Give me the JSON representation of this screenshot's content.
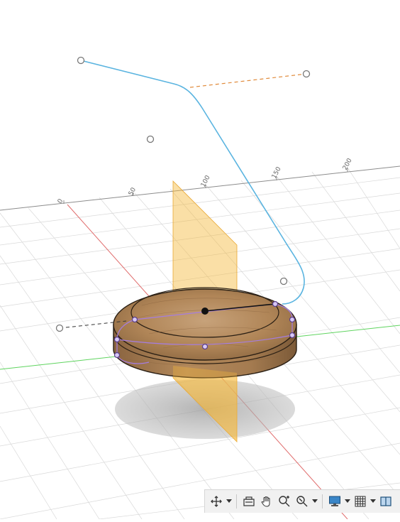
{
  "ruler": {
    "labels": [
      "0",
      "50",
      "100",
      "150",
      "200"
    ]
  },
  "colors": {
    "background": "#ffffff",
    "grid_line": "#d9d9d9",
    "x_axis": "#e06c6c",
    "y_axis": "#5fd45f",
    "path": "#5ab4e0",
    "tangent": "#e08a3a",
    "plane": "#f5b83a",
    "wood": "#b58b5e",
    "sketch": "#a57de0"
  },
  "toolbar": {
    "tools": [
      {
        "name": "orbit-icon",
        "has_dropdown": true
      },
      {
        "name": "look-at-icon",
        "has_dropdown": false
      },
      {
        "name": "pan-hand-icon",
        "has_dropdown": false
      },
      {
        "name": "zoom-icon",
        "has_dropdown": false
      },
      {
        "name": "fit-zoom-icon",
        "has_dropdown": true
      },
      {
        "name": "display-settings-icon",
        "has_dropdown": true
      },
      {
        "name": "grid-snap-icon",
        "has_dropdown": true
      },
      {
        "name": "viewports-icon",
        "has_dropdown": false
      }
    ]
  }
}
